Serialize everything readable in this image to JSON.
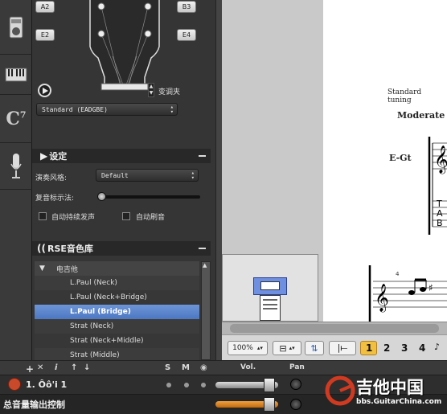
{
  "left_icons": [
    "amp-icon",
    "keyboard-icon",
    "chord-icon",
    "microphone-icon"
  ],
  "tuning": {
    "strings": [
      "A2",
      "E2",
      "B3",
      "E4"
    ],
    "transpose_label": "变调夹",
    "preset": "Standard (EADGBE)"
  },
  "settings": {
    "title": "设定",
    "style_label": "演奏风格:",
    "style_value": "Default",
    "mode_label": "复音标示法:",
    "sustain_label": "自动持续发声",
    "mute_label": "自动刷音"
  },
  "library": {
    "title": "RSE音色库",
    "group": "电吉他",
    "items": [
      "L.Paul (Neck)",
      "L.Paul (Neck+Bridge)",
      "L.Paul (Bridge)",
      "Strat (Neck)",
      "Strat (Neck+Middle)",
      "Strat (Middle)"
    ],
    "selected_index": 2
  },
  "score": {
    "tuning_text": "Standard tuning",
    "tempo_text": "Moderate",
    "track_label": "E-Gt",
    "measure_number": "4",
    "tab_letters": [
      "T",
      "A",
      "B"
    ]
  },
  "bottom_toolbar": {
    "zoom": "100%",
    "voices": [
      "1",
      "2",
      "3",
      "4"
    ],
    "active_voice": "1"
  },
  "tracks": {
    "header_symbols": [
      "+",
      "✕",
      "i",
      "↑",
      "↓"
    ],
    "solo": "S",
    "mute": "M",
    "vol_label": "Vol.",
    "pan_label": "Pan",
    "track_name": "1. Ôô'i 1",
    "master_label": "总音量输出控制"
  },
  "watermark": {
    "title": "吉他中国",
    "url": "bbs.GuitarChina.com"
  },
  "colors": {
    "selection": "#5a84cc",
    "accent_orange": "#e0902a",
    "watermark_red": "#d03a20"
  }
}
